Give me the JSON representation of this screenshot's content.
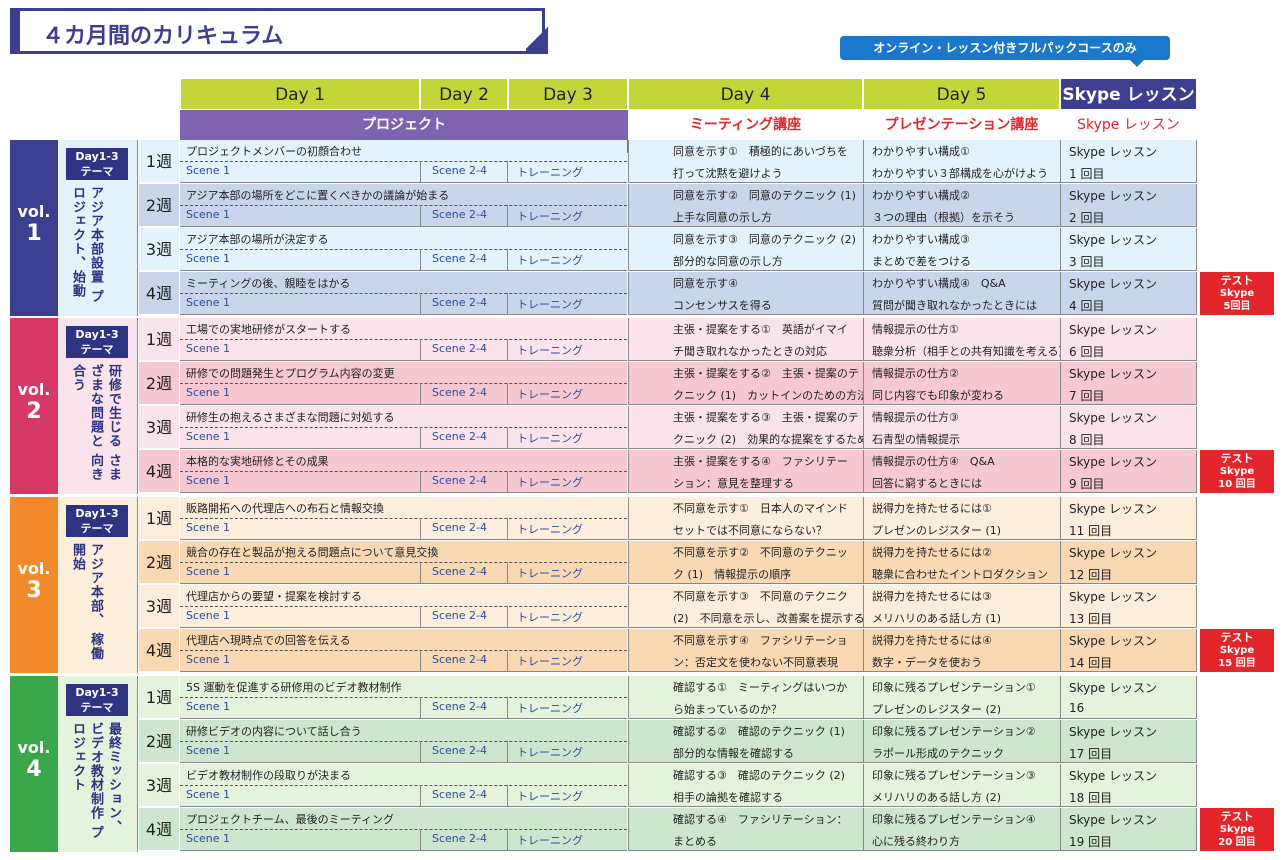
{
  "title": "４カ月間のカリキュラム",
  "note": "オンライン・レッスン付きフルパックコースのみ",
  "headers": {
    "day1": "Day 1",
    "day2": "Day 2",
    "day3": "Day 3",
    "day4": "Day 4",
    "day5": "Day 5",
    "skype": "Skype レッスン"
  },
  "subheaders": {
    "project": "プロジェクト",
    "meeting": "ミーティング講座",
    "presentation": "プレゼンテーション講座",
    "skype": "Skype レッスン"
  },
  "scene1": "Scene 1",
  "scene24": "Scene 2-4",
  "training": "トレーニング",
  "volumes": [
    {
      "vol": "vol.",
      "num": "1",
      "color": "#3c3f8f",
      "bg": "#e3f3fb",
      "alt": "#c9d5ea",
      "badge": "Day1-3\nテーマ",
      "theme": "アジア本部設置 プロジェクト、始動",
      "weeks": [
        {
          "w": "1週",
          "p": "プロジェクトメンバーの初顔合わせ",
          "d4a": "同意を示す①　積極的にあいづちを",
          "d4b": "打って沈黙を避けよう",
          "d5a": "わかりやすい構成①",
          "d5b": "わかりやすい３部構成を心がけよう",
          "sa": "Skype レッスン",
          "sb": "1 回目"
        },
        {
          "w": "2週",
          "p": "アジア本部の場所をどこに置くべきかの議論が始まる",
          "d4a": "同意を示す②　同意のテクニック (1)",
          "d4b": "上手な同意の示し方",
          "d5a": "わかりやすい構成②",
          "d5b": "３つの理由（根拠）を示そう",
          "sa": "Skype レッスン",
          "sb": "2 回目"
        },
        {
          "w": "3週",
          "p": "アジア本部の場所が決定する",
          "d4a": "同意を示す③　同意のテクニック (2)",
          "d4b": "部分的な同意の示し方",
          "d5a": "わかりやすい構成③",
          "d5b": "まとめで差をつける",
          "sa": "Skype レッスン",
          "sb": "3 回目"
        },
        {
          "w": "4週",
          "p": "ミーティングの後、親睦をはかる",
          "d4a": "同意を示す④",
          "d4b": "コンセンサスを得る",
          "d5a": "わかりやすい構成④　Q&A",
          "d5b": "質問が聞き取れなかったときには",
          "sa": "Skype レッスン",
          "sb": "4 回目"
        }
      ],
      "test": {
        "a": "テスト",
        "b": "Skype",
        "c": "5回目"
      }
    },
    {
      "vol": "vol.",
      "num": "2",
      "color": "#d63966",
      "bg": "#fbe3ec",
      "alt": "#f6c8d2",
      "badge": "Day1-3\nテーマ",
      "theme": "研修で生じる さまざまな問題と 向き合う",
      "weeks": [
        {
          "w": "1週",
          "p": "工場での実地研修がスタートする",
          "d4a": "主張・提案をする①　英語がイマイ",
          "d4b": "チ聞き取れなかったときの対応",
          "d5a": "情報提示の仕方①",
          "d5b": "聴衆分析（相手との共有知識を考える）",
          "sa": "Skype レッスン",
          "sb": "6 回目"
        },
        {
          "w": "2週",
          "p": "研修での問題発生とプログラム内容の変更",
          "d4a": "主張・提案をする②　主張・提案のテ",
          "d4b": "クニック (1)　カットインのための方法",
          "d5a": "情報提示の仕方②",
          "d5b": "同じ内容でも印象が変わる",
          "sa": "Skype レッスン",
          "sb": "7 回目"
        },
        {
          "w": "3週",
          "p": "研修生の抱えるさまざまな問題に対処する",
          "d4a": "主張・提案をする③　主張・提案のテ",
          "d4b": "クニック (2)　効果的な提案をするために",
          "d5a": "情報提示の仕方③",
          "d5b": "石青型の情報提示",
          "sa": "Skype レッスン",
          "sb": "8 回目"
        },
        {
          "w": "4週",
          "p": "本格的な実地研修とその成果",
          "d4a": "主張・提案をする④　ファシリテー",
          "d4b": "ション：意見を整理する",
          "d5a": "情報提示の仕方④　Q&A",
          "d5b": "回答に窮するときには",
          "sa": "Skype レッスン",
          "sb": "9 回目"
        }
      ],
      "test": {
        "a": "テスト",
        "b": "Skype",
        "c": "10 回目"
      }
    },
    {
      "vol": "vol.",
      "num": "3",
      "color": "#f08a2a",
      "bg": "#fdeedb",
      "alt": "#f9d8b4",
      "badge": "Day1-3\nテーマ",
      "theme": "アジア本部、 稼働開始",
      "weeks": [
        {
          "w": "1週",
          "p": "販路開拓への代理店への布石と情報交換",
          "d4a": "不同意を示す①　日本人のマインド",
          "d4b": "セットでは不同意にならない？",
          "d5a": "説得力を持たせるには①",
          "d5b": "プレゼンのレジスター (1)",
          "sa": "Skype レッスン",
          "sb": "11 回目"
        },
        {
          "w": "2週",
          "p": "競合の存在と製品が抱える問題点について意見交換",
          "d4a": "不同意を示す②　不同意のテクニッ",
          "d4b": "ク (1)　情報提示の順序",
          "d5a": "説得力を持たせるには②",
          "d5b": "聴衆に合わせたイントロダクション",
          "sa": "Skype レッスン",
          "sb": "12 回目"
        },
        {
          "w": "3週",
          "p": "代理店からの要望・提案を検討する",
          "d4a": "不同意を示す③　不同意のテクニク",
          "d4b": "(2)　不同意を示し、改善案を提示する",
          "d5a": "説得力を持たせるには③",
          "d5b": "メリハリのある話し方 (1)",
          "sa": "Skype レッスン",
          "sb": "13 回目"
        },
        {
          "w": "4週",
          "p": "代理店へ現時点での回答を伝える",
          "d4a": "不同意を示す④　ファシリテーショ",
          "d4b": "ン：否定文を使わない不同意表現",
          "d5a": "説得力を持たせるには④",
          "d5b": "数字・データを使おう",
          "sa": "Skype レッスン",
          "sb": "14 回目"
        }
      ],
      "test": {
        "a": "テスト",
        "b": "Skype",
        "c": "15 回目"
      }
    },
    {
      "vol": "vol.",
      "num": "4",
      "color": "#3aa84a",
      "bg": "#e5f2dc",
      "alt": "#cde6cf",
      "badge": "Day1-3\nテーマ",
      "theme": "最終ミッション、 ビデオ教材制作 プロジェクト",
      "weeks": [
        {
          "w": "1週",
          "p": "5S 運動を促進する研修用のビデオ教材制作",
          "d4a": "確認する①　ミーティングはいつか",
          "d4b": "ら始まっているのか？",
          "d5a": "印象に残るプレゼンテーション①",
          "d5b": "プレゼンのレジスター (2)",
          "sa": "Skype レッスン",
          "sb": "16"
        },
        {
          "w": "2週",
          "p": "研修ビデオの内容について話し合う",
          "d4a": "確認する②　確認のテクニック (1)",
          "d4b": "部分的な情報を確認する",
          "d5a": "印象に残るプレゼンテーション②",
          "d5b": "ラポール形成のテクニック",
          "sa": "Skype レッスン",
          "sb": "17 回目"
        },
        {
          "w": "3週",
          "p": "ビデオ教材制作の段取りが決まる",
          "d4a": "確認する③　確認のテクニック (2)",
          "d4b": "相手の論拠を確認する",
          "d5a": "印象に残るプレゼンテーション③",
          "d5b": "メリハリのある話し方 (2)",
          "sa": "Skype レッスン",
          "sb": "18 回目"
        },
        {
          "w": "4週",
          "p": "プロジェクトチーム、最後のミーティング",
          "d4a": "確認する④　ファシリテーション：",
          "d4b": "まとめる",
          "d5a": "印象に残るプレゼンテーション④",
          "d5b": "心に残る終わり方",
          "sa": "Skype レッスン",
          "sb": "19 回目"
        }
      ],
      "test": {
        "a": "テスト",
        "b": "Skype",
        "c": "20 回目"
      }
    }
  ]
}
